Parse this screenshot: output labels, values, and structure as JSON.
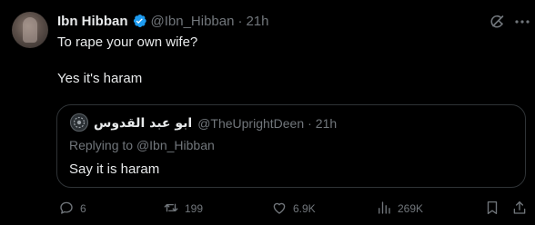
{
  "tweet": {
    "author": {
      "display_name": "Ibn Hibban",
      "handle": "@Ibn_Hibban",
      "separator": "·",
      "time": "21h",
      "verified": true,
      "verified_color": "#1d9bf0"
    },
    "lines": [
      "To rape your own wife?",
      "Yes it's haram"
    ]
  },
  "quote": {
    "author": {
      "display_name": "ابو عبد القدوس",
      "handle": "@TheUprightDeen",
      "separator": "·",
      "time": "21h"
    },
    "replying_prefix": "Replying to",
    "replying_to": "@Ibn_Hibban",
    "text": "Say it is haram"
  },
  "actions": {
    "replies": "6",
    "retweets": "199",
    "likes": "6.9K",
    "views": "269K"
  },
  "icons": {
    "top_right": [
      "grok-icon",
      "more-icon"
    ],
    "action_bar": [
      "reply-icon",
      "retweet-icon",
      "like-icon",
      "views-icon",
      "bookmark-icon",
      "share-icon"
    ]
  },
  "colors": {
    "background": "#000000",
    "text": "#e7e9ea",
    "secondary": "#71767b",
    "border": "#2f3336"
  }
}
